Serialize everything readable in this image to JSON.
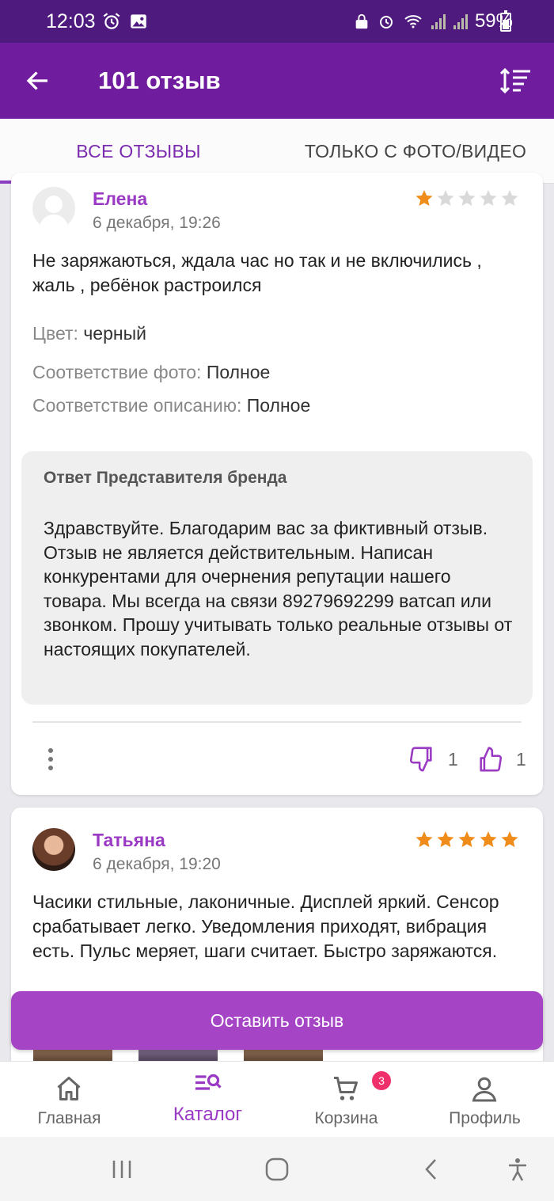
{
  "status_bar": {
    "time": "12:03",
    "battery": "59%"
  },
  "app_bar": {
    "title": "101 отзыв"
  },
  "tabs": [
    {
      "label": "ВСЕ ОТЗЫВЫ",
      "active": true
    },
    {
      "label": "ТОЛЬКО С ФОТО/ВИДЕО",
      "active": false
    }
  ],
  "reviews": [
    {
      "author": "Елена",
      "date": "6 декабря, 19:26",
      "rating": 1,
      "text": "Не заряжаються, ждала час но так и не включились , жаль , ребёнок растроился",
      "props": [
        {
          "label": "Цвет:",
          "value": "черный"
        },
        {
          "label": "Соответствие фото:",
          "value": "Полное"
        },
        {
          "label": "Соответствие описанию:",
          "value": "Полное"
        }
      ],
      "reply": {
        "title": "Ответ Представителя бренда",
        "text": "Здравствуйте. Благодарим вас за фиктивный отзыв. Отзыв не является действительным. Написан конкурентами для очернения репутации нашего товара. Мы всегда на связи 89279692299 ватсап или звонком. Прошу учитывать только реальные отзывы от настоящих покупателей."
      },
      "dislikes": "1",
      "likes": "1"
    },
    {
      "author": "Татьяна",
      "date": "6 декабря, 19:20",
      "rating": 5,
      "text": "Часики стильные, лаконичные. Дисплей яркий. Сенсор срабатывает легко. Уведомления приходят, вибрация есть. Пульс меряет, шаги считает. Быстро заряжаются."
    }
  ],
  "cta": {
    "label": "Оставить отзыв"
  },
  "bottom_nav": [
    {
      "label": "Главная",
      "icon": "home-icon"
    },
    {
      "label": "Каталог",
      "icon": "catalog-search-icon",
      "active": true
    },
    {
      "label": "Корзина",
      "icon": "cart-icon",
      "badge": "3"
    },
    {
      "label": "Профиль",
      "icon": "profile-icon"
    }
  ],
  "colors": {
    "primary": "#6f1d9e",
    "accent": "#9a39c3",
    "star": "#f08c1a",
    "cta": "#a545c6",
    "badge": "#f0306a"
  }
}
